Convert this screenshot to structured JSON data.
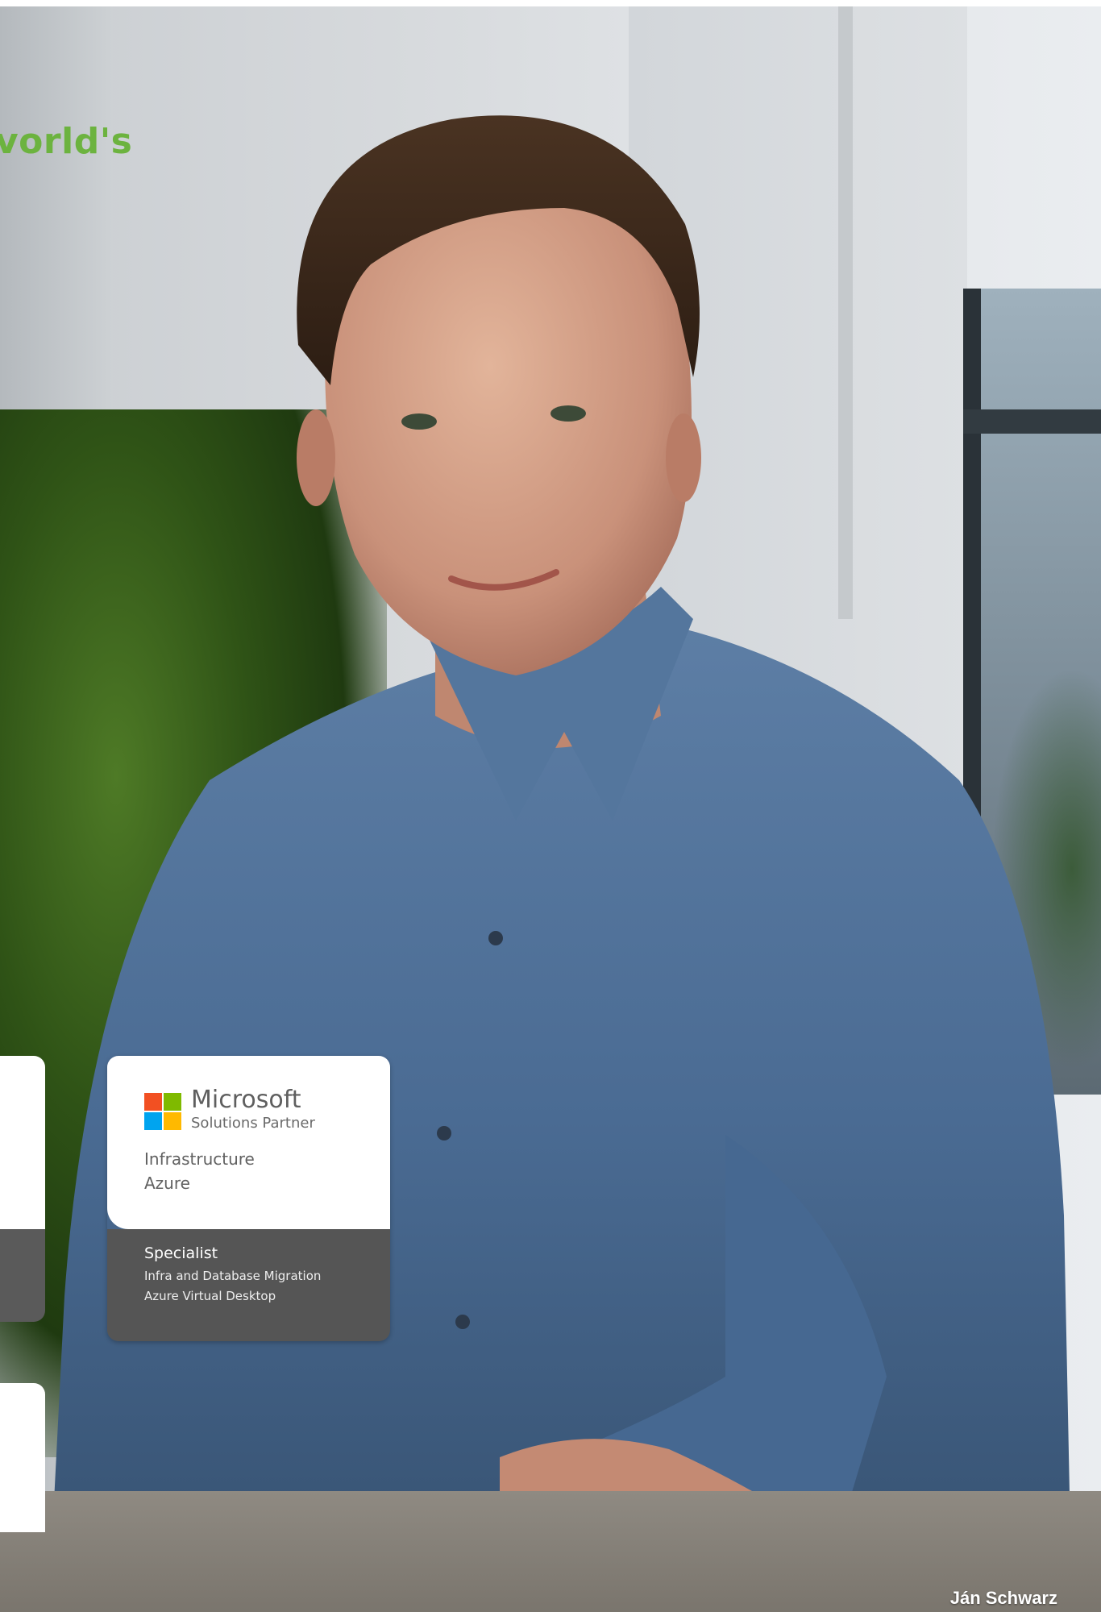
{
  "headline": {
    "text": "vorld's",
    "color": "#6cb33f"
  },
  "badge": {
    "brand": "Microsoft",
    "program": "Solutions Partner",
    "areas": [
      "Infrastructure",
      "Azure"
    ],
    "specialist_label": "Specialist",
    "specializations": [
      "Infra and Database Migration",
      "Azure Virtual Desktop"
    ],
    "logo_icon": "microsoft-logo-icon",
    "logo_colors": [
      "#f25022",
      "#7fba00",
      "#00a4ef",
      "#ffb900"
    ]
  },
  "photo": {
    "caption": "Ján Schwarz"
  }
}
